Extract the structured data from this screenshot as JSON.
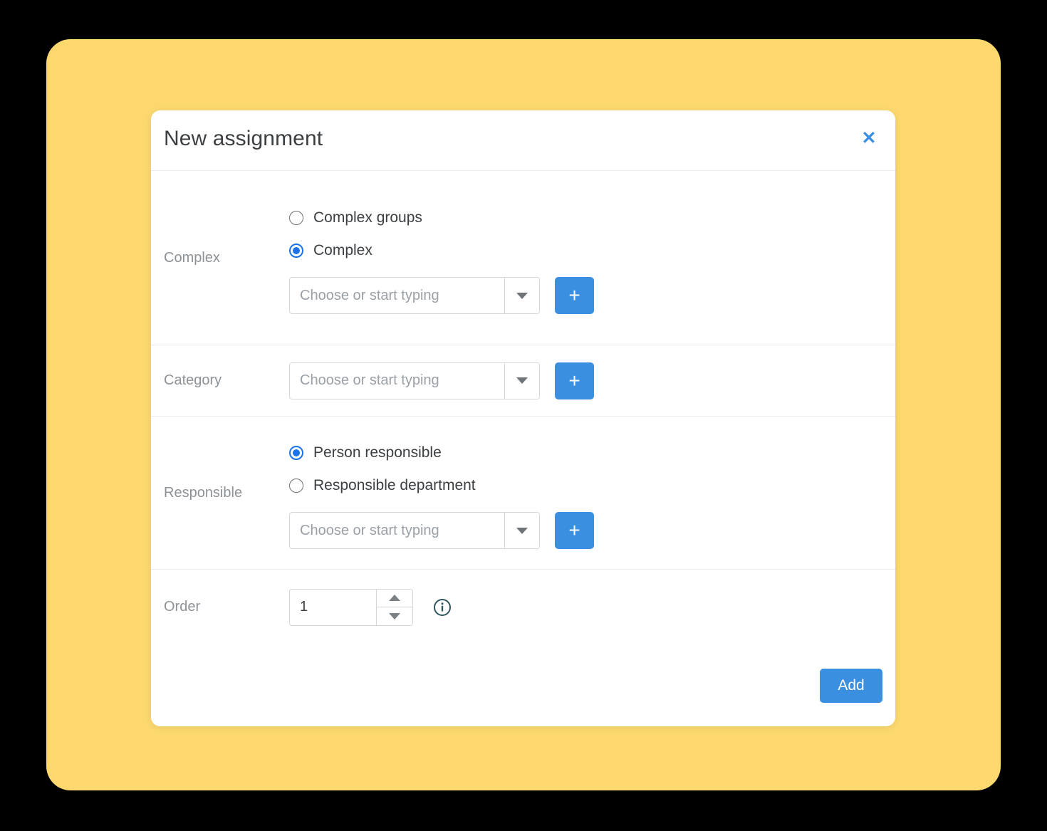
{
  "theme": {
    "backdrop_color": "#000000",
    "stage_color": "#fcd86f",
    "accent_color": "#3b8fe0",
    "radio_accent_color": "#1a73e8",
    "dialog_background": "#ffffff",
    "divider_color": "#e9ebee",
    "label_color": "#8d9296",
    "text_color": "#3c4043",
    "placeholder_color": "#9aa0a6"
  },
  "dialog": {
    "title": "New assignment",
    "close_label": "✕",
    "close_icon": "close-icon"
  },
  "rows": {
    "complex": {
      "label": "Complex",
      "options": [
        {
          "label": "Complex groups",
          "selected": false
        },
        {
          "label": "Complex",
          "selected": true
        }
      ],
      "select": {
        "value": "",
        "placeholder": "Choose or start typing",
        "dropdown_icon": "chevron-down-icon"
      },
      "add_button": {
        "label": "+",
        "icon": "plus-icon"
      }
    },
    "category": {
      "label": "Category",
      "select": {
        "value": "",
        "placeholder": "Choose or start typing",
        "dropdown_icon": "chevron-down-icon"
      },
      "add_button": {
        "label": "+",
        "icon": "plus-icon"
      }
    },
    "responsible": {
      "label": "Responsible",
      "options": [
        {
          "label": "Person responsible",
          "selected": true
        },
        {
          "label": "Responsible department",
          "selected": false
        }
      ],
      "select": {
        "value": "",
        "placeholder": "Choose or start typing",
        "dropdown_icon": "chevron-down-icon"
      },
      "add_button": {
        "label": "+",
        "icon": "plus-icon"
      }
    },
    "order": {
      "label": "Order",
      "value": "1",
      "placeholder": "",
      "increment_icon": "caret-up-icon",
      "decrement_icon": "caret-down-icon",
      "info_icon": "info-icon"
    }
  },
  "footer": {
    "add_label": "Add"
  }
}
